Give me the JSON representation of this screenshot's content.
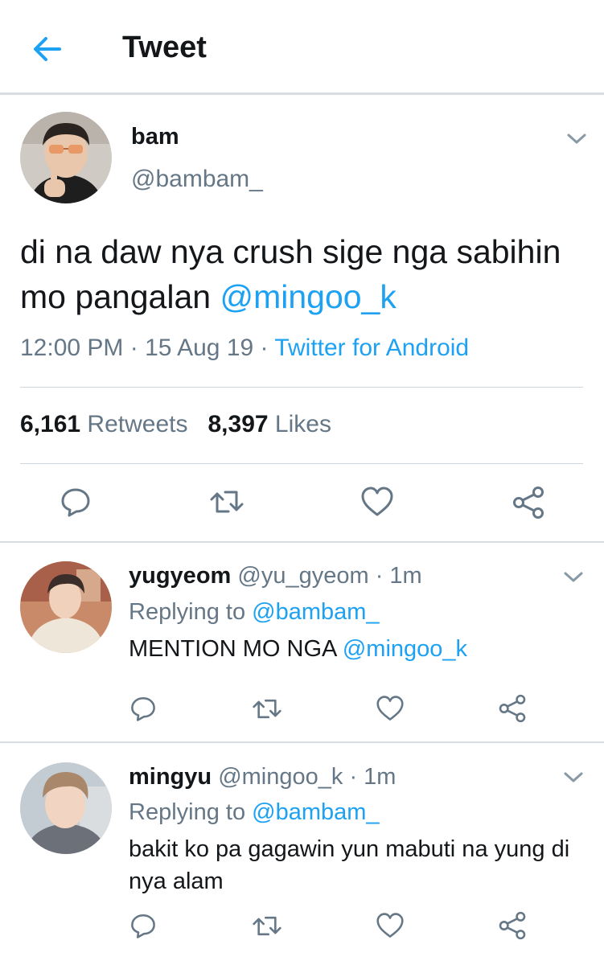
{
  "header": {
    "title": "Tweet"
  },
  "tweet": {
    "name": "bam",
    "handle": "@bambam_",
    "text": "di na daw nya crush sige nga sabihin mo pangalan ",
    "mention": "@mingoo_k",
    "time": "12:00 PM · 15 Aug 19 · ",
    "source": "Twitter for Android",
    "retweets_count": "6,161",
    "retweets_label": "Retweets",
    "likes_count": "8,397",
    "likes_label": "Likes"
  },
  "replies": [
    {
      "name": "yugyeom",
      "handle": "@yu_gyeom",
      "time": "· 1m",
      "replying_label": "Replying to ",
      "replying_to": "@bambam_",
      "text": "MENTION MO NGA ",
      "mention": "@mingoo_k"
    },
    {
      "name": "mingyu",
      "handle": "@mingoo_k",
      "time": "· 1m",
      "replying_label": "Replying to ",
      "replying_to": "@bambam_",
      "text": "bakit ko pa gagawin yun mabuti na yung di nya alam"
    }
  ],
  "colors": {
    "accent": "#1da1f2",
    "secondary_text": "#657786",
    "divider": "#ccd6dd"
  },
  "icons": [
    "back-arrow-icon",
    "chevron-down-icon",
    "reply-icon",
    "retweet-icon",
    "like-icon",
    "share-icon"
  ]
}
